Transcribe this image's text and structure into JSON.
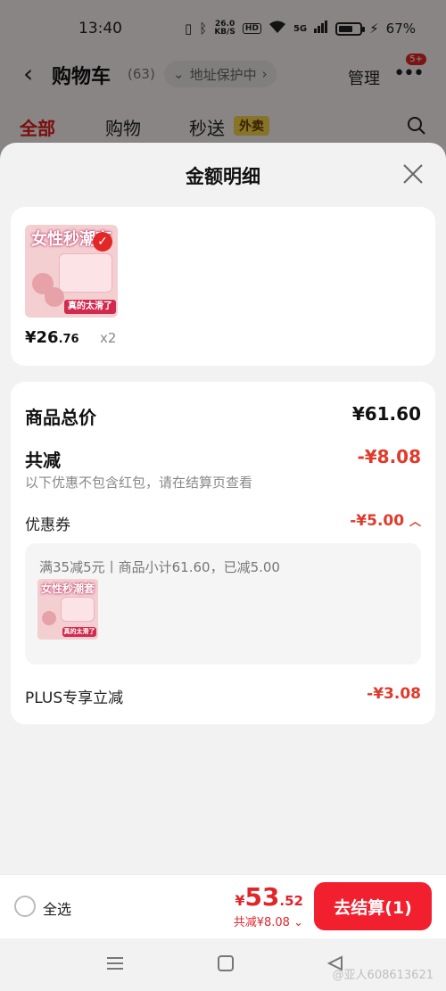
{
  "status_bar": {
    "time": "13:40",
    "net_speed": "26.0",
    "net_unit": "KB/S",
    "hd": "HD",
    "signal": "5G",
    "battery": "67%",
    "battery_level": 0.67
  },
  "nav": {
    "title": "购物车",
    "count": "(63)",
    "address": "地址保护中",
    "manage": "管理",
    "more_badge": "5+"
  },
  "tabs": {
    "all": "全部",
    "shopping": "购物",
    "express": "秒送",
    "express_badge": "外卖"
  },
  "sheet": {
    "title": "金额明细",
    "product": {
      "thumb_title": "女性秒潮套",
      "thumb_banner": "真的太滑了",
      "price_int": "¥26",
      "price_dec": ".76",
      "qty": "x2"
    },
    "subtotal_label": "商品总价",
    "subtotal_value": "¥61.60",
    "discount_label": "共减",
    "discount_value": "-¥8.08",
    "discount_note": "以下优惠不包含红包，请在结算页查看",
    "coupon_label": "优惠券",
    "coupon_value": "-¥5.00",
    "coupon_detail": "满35减5元丨商品小计61.60，已减5.00",
    "plus_label": "PLUS专享立减",
    "plus_value": "-¥3.08"
  },
  "bottom": {
    "select_all": "全选",
    "currency": "¥",
    "total_int": "53",
    "total_dec": ".52",
    "saved": "共减¥8.08",
    "checkout": "去结算(1)"
  },
  "watermark": "@亚人608613621",
  "colors": {
    "accent_red": "#f21f2e",
    "price_red": "#e03a2b",
    "badge_yellow": "#f4d44a"
  }
}
